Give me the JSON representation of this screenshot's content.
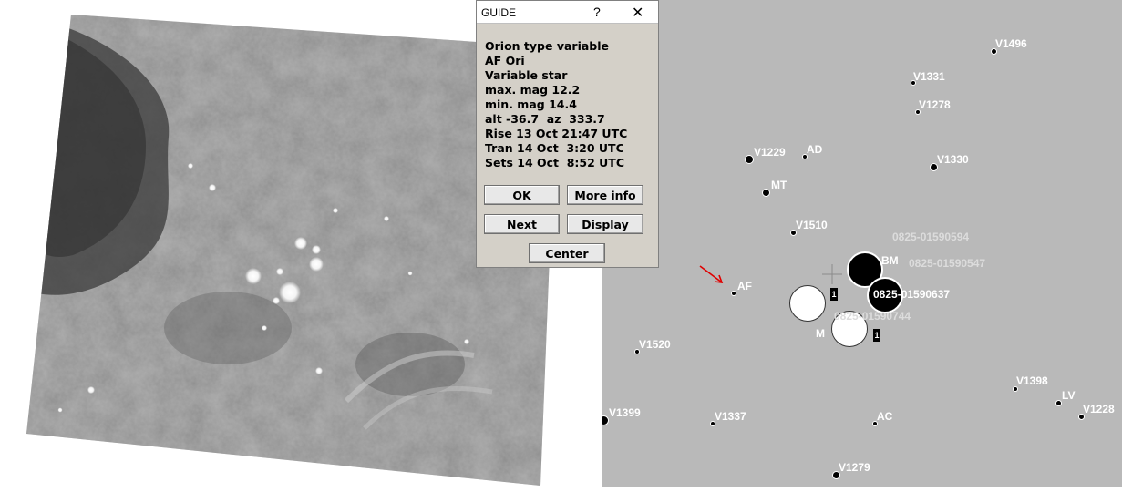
{
  "dialog": {
    "title": "GUIDE",
    "help_label": "?",
    "close_label": "✕",
    "info_lines": [
      "Orion type variable",
      "AF Ori",
      "Variable star",
      "max. mag 12.2",
      "min. mag 14.4",
      "alt -36.7  az  333.7",
      "Rise 13 Oct 21:47 UTC",
      "Tran 14 Oct  3:20 UTC",
      "Sets 14 Oct  8:52 UTC"
    ],
    "buttons": {
      "ok": "OK",
      "more_info": "More info",
      "next": "Next",
      "display": "Display",
      "center": "Center"
    }
  },
  "chart": {
    "background_color": "#b9b9b9",
    "label_color": "#ffffff",
    "arrow_color": "#e00000",
    "object_labels": [
      "V1496",
      "V1331",
      "V1278",
      "V1229",
      "AD",
      "V1330",
      "MT",
      "V1510",
      "0825-01590594",
      "BM",
      "0825-01590547",
      "AF",
      "0825-01590637",
      "0825-01590744",
      "M",
      "V1520",
      "V1398",
      "LV",
      "V1228",
      "V1399",
      "V1337",
      "AC",
      "V1279"
    ],
    "tags": [
      "1",
      "1"
    ]
  }
}
